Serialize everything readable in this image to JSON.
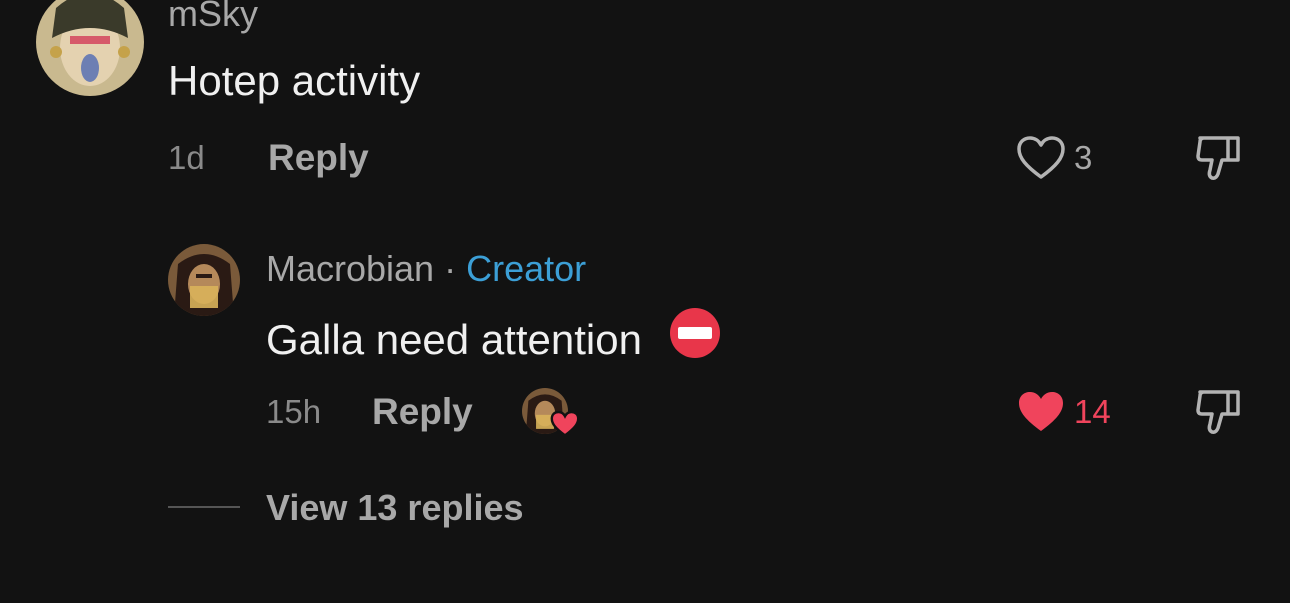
{
  "comment1": {
    "username": "mSky",
    "text": "Hotep activity",
    "time": "1d",
    "reply_label": "Reply",
    "like_count": "3"
  },
  "comment2": {
    "username": "Macrobian",
    "separator": "·",
    "badge": "Creator",
    "text": "Galla need attention",
    "emoji": "⛔",
    "time": "15h",
    "reply_label": "Reply",
    "like_count": "14"
  },
  "thread": {
    "view_replies_label": "View 13 replies"
  },
  "colors": {
    "background": "#121212",
    "creator_badge": "#3c9fd6",
    "liked_heart": "#f0445c"
  }
}
